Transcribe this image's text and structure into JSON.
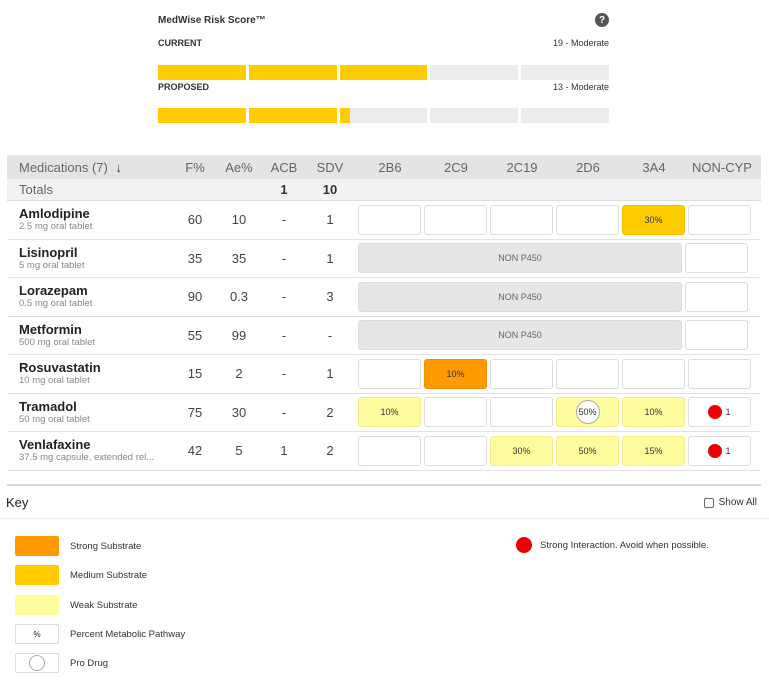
{
  "risk_score": {
    "title": "MedWise Risk Score™",
    "help_icon": "question-icon",
    "current": {
      "label": "CURRENT",
      "score": "19 - Moderate",
      "segment_fill": [
        1,
        1,
        1,
        0,
        0
      ]
    },
    "proposed": {
      "label": "PROPOSED",
      "score": "13 - Moderate",
      "segment_fill": [
        1,
        1,
        0.12,
        0,
        0
      ]
    },
    "fill_color": "#ffcc00",
    "empty_color": "#ececec"
  },
  "table": {
    "headers": {
      "medications": "Medications (7)",
      "sort_icon": "↓",
      "f": "F%",
      "ae": "Ae%",
      "acb": "ACB",
      "sdv": "SDV",
      "cyp": [
        "2B6",
        "2C9",
        "2C19",
        "2D6",
        "3A4"
      ],
      "noncyp": "NON-CYP"
    },
    "totals": {
      "label": "Totals",
      "acb": "1",
      "sdv": "10"
    },
    "non_p450_label": "NON P450",
    "rows": [
      {
        "name": "Amlodipine",
        "dose": "2.5 mg oral tablet",
        "f": "60",
        "ae": "10",
        "acb": "-",
        "sdv": "1",
        "cyp": [
          {
            "t": "",
            "s": ""
          },
          {
            "t": "",
            "s": ""
          },
          {
            "t": "",
            "s": ""
          },
          {
            "t": "",
            "s": ""
          },
          {
            "t": "30%",
            "s": "medium"
          }
        ],
        "noncyp": {
          "count": "",
          "dot": false
        }
      },
      {
        "name": "Lisinopril",
        "dose": "5 mg oral tablet",
        "f": "35",
        "ae": "35",
        "acb": "-",
        "sdv": "1",
        "non_p450": true,
        "noncyp": {
          "count": "",
          "dot": false
        }
      },
      {
        "name": "Lorazepam",
        "dose": "0.5 mg oral tablet",
        "f": "90",
        "ae": "0.3",
        "acb": "-",
        "sdv": "3",
        "non_p450": true,
        "noncyp": {
          "count": "",
          "dot": false
        }
      },
      {
        "name": "Metformin",
        "dose": "500 mg oral tablet",
        "f": "55",
        "ae": "99",
        "acb": "-",
        "sdv": "-",
        "non_p450": true,
        "noncyp": {
          "count": "",
          "dot": false
        }
      },
      {
        "name": "Rosuvastatin",
        "dose": "10 mg oral tablet",
        "f": "15",
        "ae": "2",
        "acb": "-",
        "sdv": "1",
        "cyp": [
          {
            "t": "",
            "s": ""
          },
          {
            "t": "10%",
            "s": "strong"
          },
          {
            "t": "",
            "s": ""
          },
          {
            "t": "",
            "s": ""
          },
          {
            "t": "",
            "s": ""
          }
        ],
        "noncyp": {
          "count": "",
          "dot": false
        }
      },
      {
        "name": "Tramadol",
        "dose": "50 mg oral tablet",
        "f": "75",
        "ae": "30",
        "acb": "-",
        "sdv": "2",
        "cyp": [
          {
            "t": "10%",
            "s": "weak"
          },
          {
            "t": "",
            "s": ""
          },
          {
            "t": "",
            "s": ""
          },
          {
            "t": "50%",
            "s": "weak",
            "prodrug": true
          },
          {
            "t": "10%",
            "s": "weak"
          }
        ],
        "noncyp": {
          "count": "1",
          "dot": true
        }
      },
      {
        "name": "Venlafaxine",
        "dose": "37.5 mg capsule, extended rel...",
        "f": "42",
        "ae": "5",
        "acb": "1",
        "sdv": "2",
        "cyp": [
          {
            "t": "",
            "s": ""
          },
          {
            "t": "",
            "s": ""
          },
          {
            "t": "30%",
            "s": "weak"
          },
          {
            "t": "50%",
            "s": "weak"
          },
          {
            "t": "15%",
            "s": "weak"
          }
        ],
        "noncyp": {
          "count": "1",
          "dot": true
        }
      }
    ]
  },
  "key": {
    "title": "Key",
    "show_all": "Show All",
    "items": [
      {
        "swatch": "strong",
        "label": "Strong Substrate"
      },
      {
        "swatch": "medium",
        "label": "Medium Substrate"
      },
      {
        "swatch": "weak",
        "label": "Weak Substrate"
      },
      {
        "swatch": "percent",
        "symbol": "%",
        "label": "Percent Metabolic Pathway"
      },
      {
        "swatch": "prodrug",
        "label": "Pro Drug"
      }
    ],
    "interaction": "Strong Interaction. Avoid when possible.",
    "colors": {
      "strong": "#ff9a00",
      "medium": "#ffcc00",
      "weak": "#fffc9e",
      "interaction": "#ee0000"
    }
  }
}
